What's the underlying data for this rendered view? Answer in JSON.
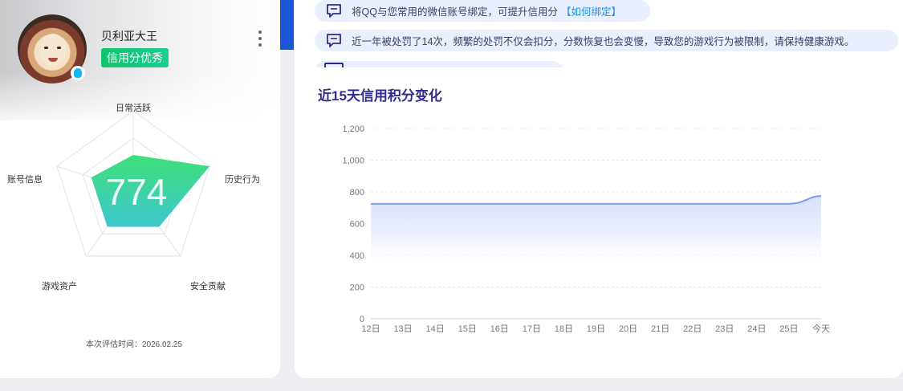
{
  "profile": {
    "username": "贝利亚大王",
    "credit_badge": "信用分优秀",
    "score": "774",
    "radar_labels": {
      "daily_activity": "日常活跃",
      "history_behavior": "历史行为",
      "security_contribution": "安全贡献",
      "game_assets": "游戏资产",
      "account_info": "账号信息"
    },
    "radar_values": [
      0.45,
      1.0,
      0.55,
      0.55,
      0.55
    ],
    "eval_time": "本次评估时间：2026.02.25",
    "icons": {
      "more": "more-vertical-icon",
      "qq": "qq-icon"
    }
  },
  "notices": [
    {
      "text": "将QQ与您常用的微信账号绑定，可提升信用分",
      "link": "【如何绑定】"
    },
    {
      "text": "近一年被处罚了14次，频繁的处罚不仅会扣分，分数恢复也会变慢，导致您的游戏行为被限制，请保持健康游戏。"
    }
  ],
  "chart_section_title": "近15天信用积分变化",
  "chart_data": {
    "type": "area",
    "title": "近15天信用积分变化",
    "categories": [
      "12日",
      "13日",
      "14日",
      "15日",
      "16日",
      "17日",
      "18日",
      "19日",
      "20日",
      "21日",
      "22日",
      "23日",
      "24日",
      "25日",
      "今天"
    ],
    "values": [
      725,
      725,
      725,
      725,
      725,
      725,
      725,
      725,
      725,
      725,
      725,
      725,
      725,
      725,
      774
    ],
    "ylim": [
      0,
      1200
    ],
    "yticks": [
      "0",
      "200",
      "400",
      "600",
      "800",
      "1,000",
      "1,200"
    ],
    "grid": true,
    "line_color": "#7a9ef0",
    "fill_color": "#dfe6fd"
  },
  "colors": {
    "accent": "#1b56d6",
    "badge": "#18c66e",
    "notice_bg": "#e9effc",
    "link": "#1e8ef3",
    "title": "#2f2d8c"
  }
}
